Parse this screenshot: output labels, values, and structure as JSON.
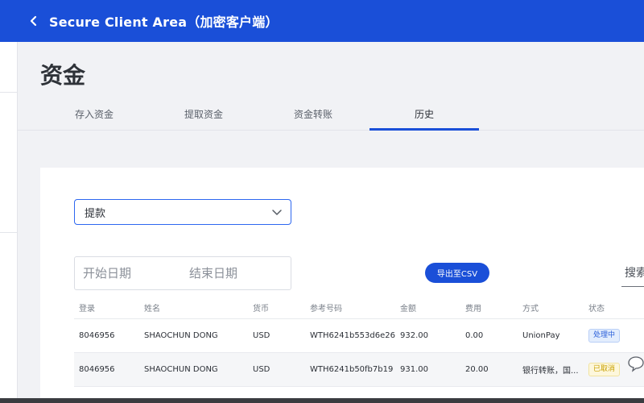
{
  "header": {
    "title": "Secure Client Area（加密客户端）"
  },
  "page": {
    "heading": "资金"
  },
  "tabs": [
    {
      "label": "存入资金",
      "active": false
    },
    {
      "label": "提取资金",
      "active": false
    },
    {
      "label": "资金转账",
      "active": false
    },
    {
      "label": "历史",
      "active": true
    }
  ],
  "filters": {
    "type_selected": "提款",
    "start_date_placeholder": "开始日期",
    "end_date_placeholder": "结束日期",
    "export_label": "导出至CSV",
    "search_placeholder": "搜索"
  },
  "table": {
    "columns": [
      "登录",
      "姓名",
      "货币",
      "参考号码",
      "金额",
      "费用",
      "方式",
      "状态"
    ],
    "rows": [
      {
        "login": "8046956",
        "name": "SHAOCHUN DONG",
        "currency": "USD",
        "reference": "WTH6241b553d6e26",
        "amount": "932.00",
        "fee": "0.00",
        "method": "UnionPay",
        "status": "处理中"
      },
      {
        "login": "8046956",
        "name": "SHAOCHUN DONG",
        "currency": "USD",
        "reference": "WTH6241b50fb7b19",
        "amount": "931.00",
        "fee": "20.00",
        "method": "银行转账，国...",
        "status": "已取消"
      }
    ]
  },
  "colors": {
    "brand_blue": "#1a4fd8",
    "background": "#f1f2f5",
    "status_processing": "#2a5fd9",
    "status_cancelled": "#c9a000"
  },
  "icons": {
    "back": "chevron-left-icon",
    "select_arrow": "chevron-down-icon",
    "chat": "chat-bubble-icon"
  }
}
